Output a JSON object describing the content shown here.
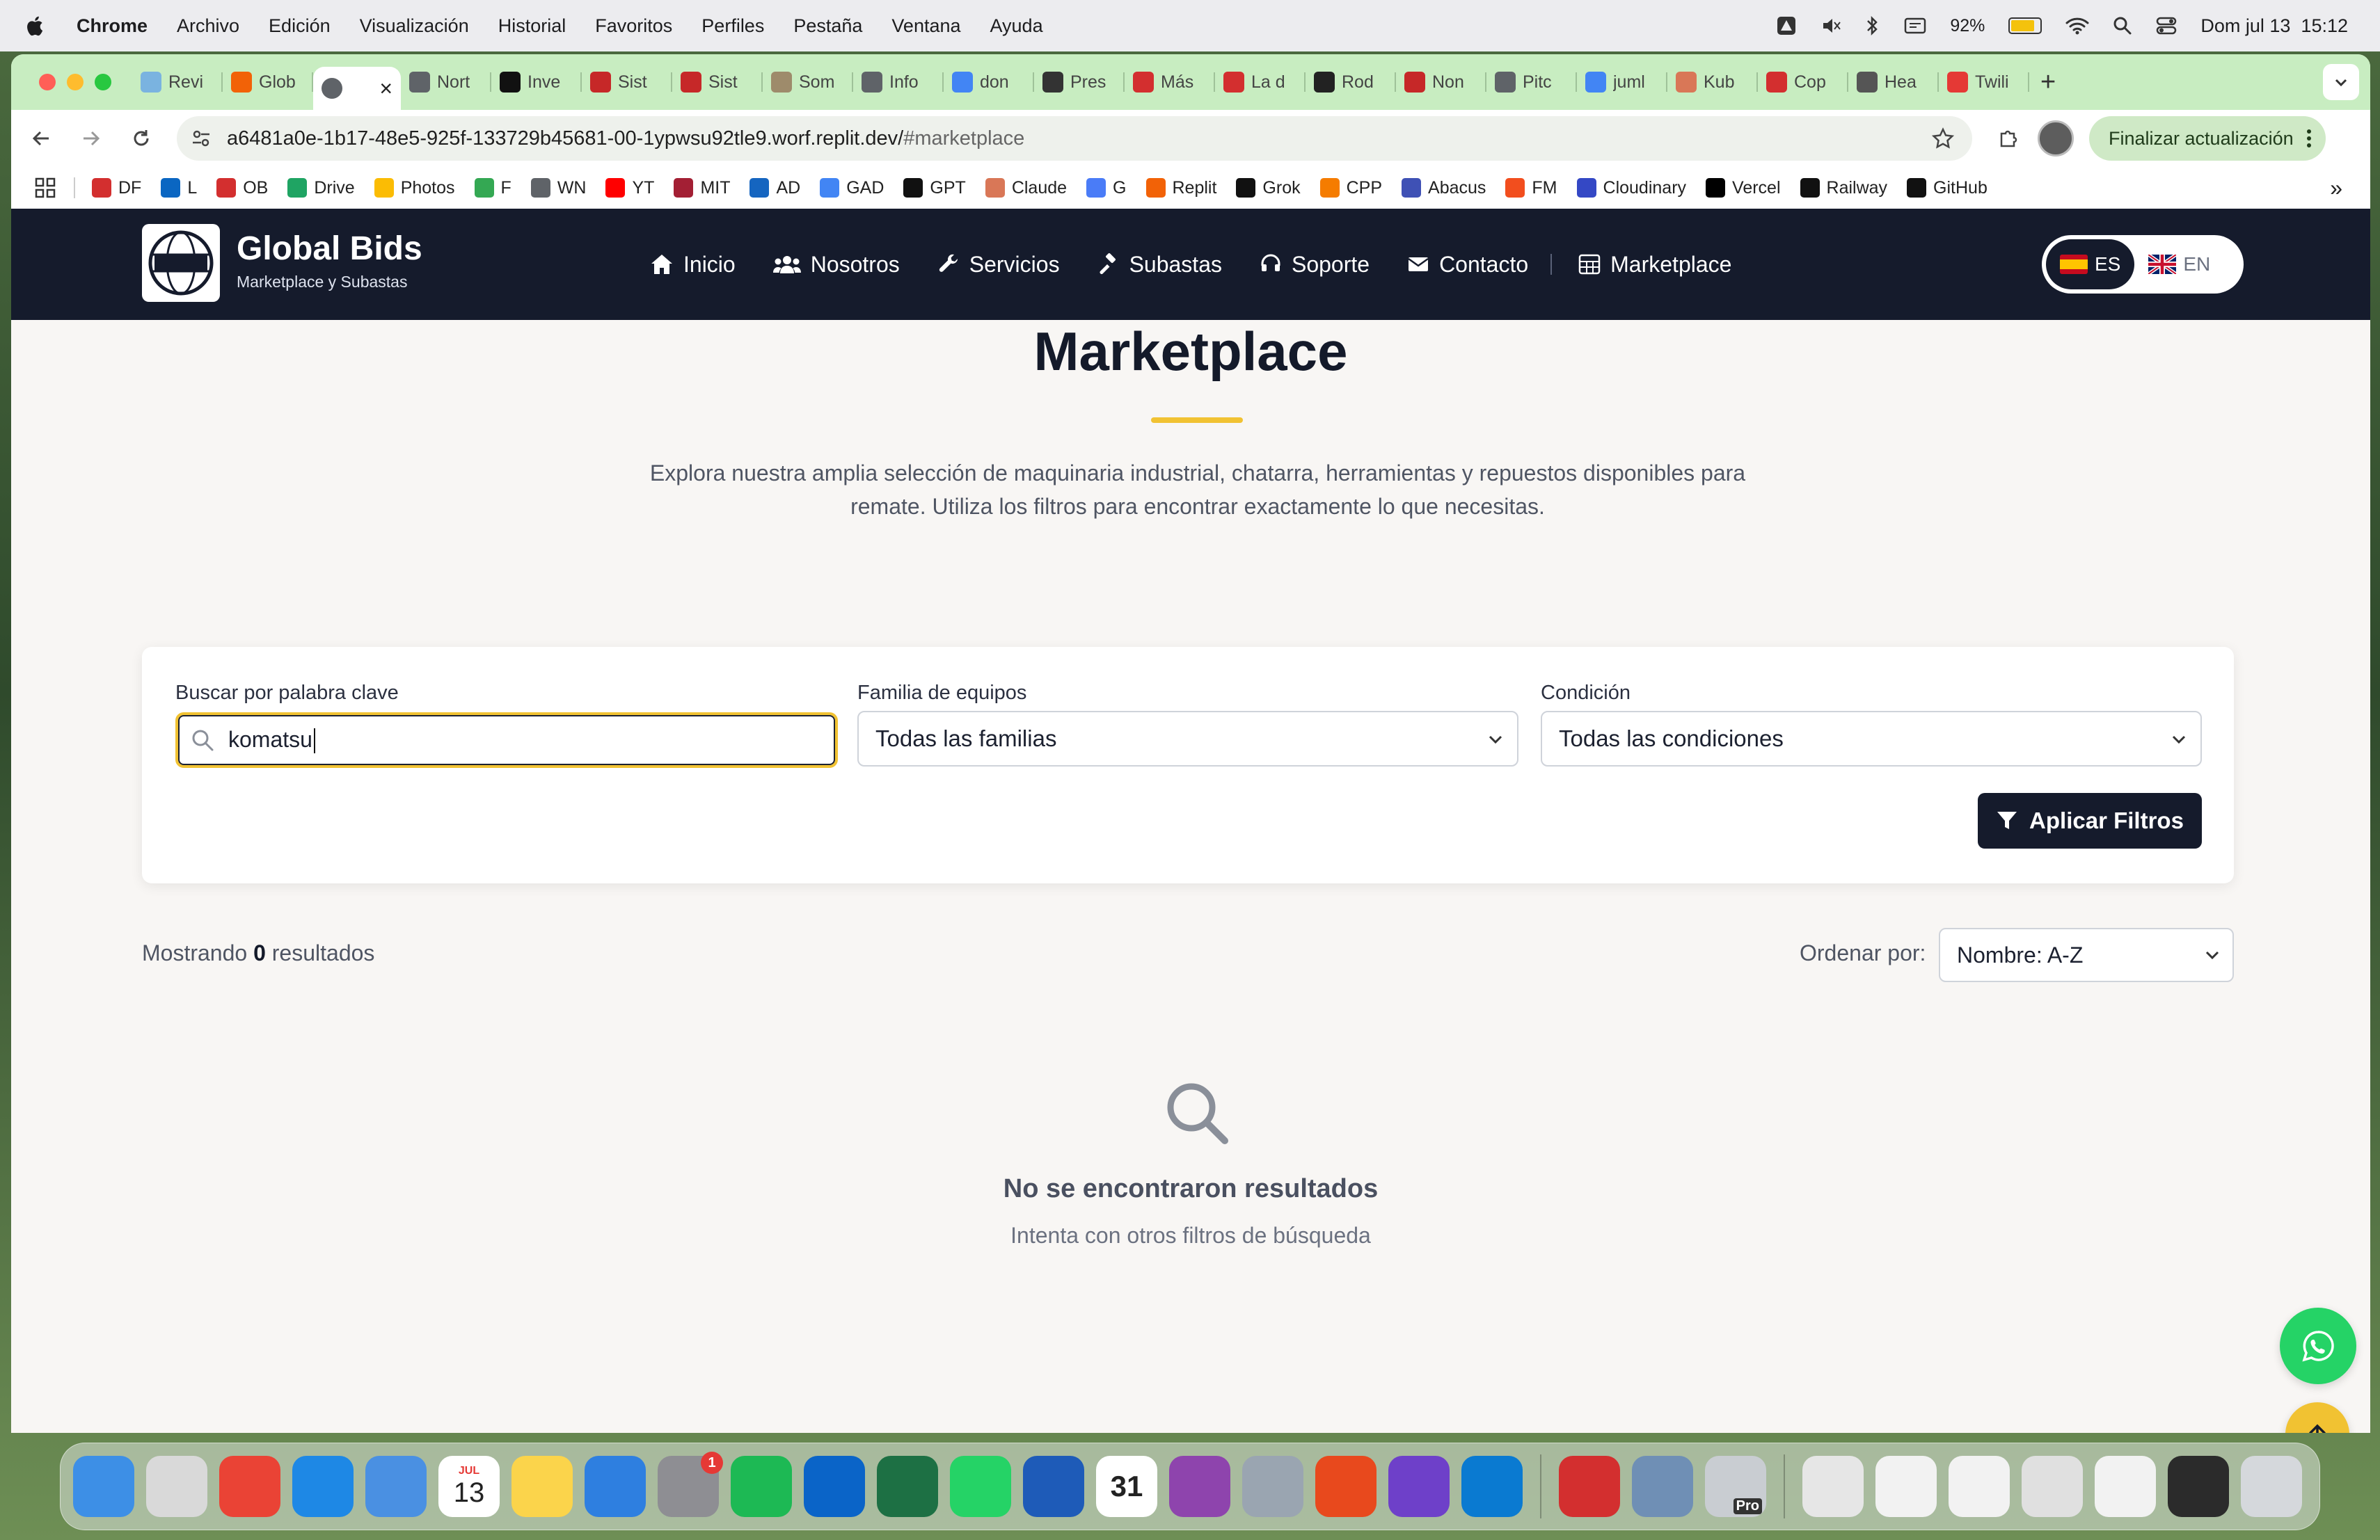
{
  "menubar": {
    "app": "Chrome",
    "items": [
      "Archivo",
      "Edición",
      "Visualización",
      "Historial",
      "Favoritos",
      "Perfiles",
      "Pestaña",
      "Ventana",
      "Ayuda"
    ],
    "battery": "92%",
    "battery_level": 0.92,
    "clock": "Dom jul 13  15:12"
  },
  "tabs": [
    {
      "title": "Revi",
      "color": "#7ab3e0"
    },
    {
      "title": "Glob",
      "color": "#f26207"
    },
    {
      "title": "",
      "color": "#5f6368",
      "active": true
    },
    {
      "title": "Nort",
      "color": "#5f6368"
    },
    {
      "title": "Inve",
      "color": "#111111"
    },
    {
      "title": "Sist",
      "color": "#c62828"
    },
    {
      "title": "Sist",
      "color": "#c62828"
    },
    {
      "title": "Som",
      "color": "#9e8b6b"
    },
    {
      "title": "Info",
      "color": "#5f6368"
    },
    {
      "title": "don",
      "color": "#4285f4"
    },
    {
      "title": "Pres",
      "color": "#333333"
    },
    {
      "title": "Más",
      "color": "#d32f2f"
    },
    {
      "title": "La d",
      "color": "#d32f2f"
    },
    {
      "title": "Rod",
      "color": "#222222"
    },
    {
      "title": "Non",
      "color": "#c62828"
    },
    {
      "title": "Pitc",
      "color": "#5f6368"
    },
    {
      "title": "juml",
      "color": "#4285f4"
    },
    {
      "title": "Kub",
      "color": "#d97757"
    },
    {
      "title": "Cop",
      "color": "#d32f2f"
    },
    {
      "title": "Hea",
      "color": "#555555"
    },
    {
      "title": "Twili",
      "color": "#e53935"
    }
  ],
  "address": {
    "url": "a6481a0e-1b17-48e5-925f-133729b45681-00-1ypwsu92tle9.worf.replit.dev/",
    "hash": "#marketplace"
  },
  "update_button": "Finalizar actualización",
  "bookmarks": [
    {
      "label": "DF",
      "color": "#d32f2f"
    },
    {
      "label": "L",
      "color": "#0a66c2"
    },
    {
      "label": "OB",
      "color": "#d32f2f"
    },
    {
      "label": "Drive",
      "color": "#1fa463"
    },
    {
      "label": "Photos",
      "color": "#fbbc04"
    },
    {
      "label": "F",
      "color": "#34a853"
    },
    {
      "label": "WN",
      "color": "#5f6368"
    },
    {
      "label": "YT",
      "color": "#ff0000"
    },
    {
      "label": "MIT",
      "color": "#a31f34"
    },
    {
      "label": "AD",
      "color": "#1565c0"
    },
    {
      "label": "GAD",
      "color": "#4285f4"
    },
    {
      "label": "GPT",
      "color": "#111111"
    },
    {
      "label": "Claude",
      "color": "#d97757"
    },
    {
      "label": "G",
      "color": "#4a7cf7"
    },
    {
      "label": "Replit",
      "color": "#f26207"
    },
    {
      "label": "Grok",
      "color": "#111111"
    },
    {
      "label": "CPP",
      "color": "#f57c00"
    },
    {
      "label": "Abacus",
      "color": "#3f51b5"
    },
    {
      "label": "FM",
      "color": "#f24e1e"
    },
    {
      "label": "Cloudinary",
      "color": "#3448c5"
    },
    {
      "label": "Vercel",
      "color": "#000000"
    },
    {
      "label": "Railway",
      "color": "#111111"
    },
    {
      "label": "GitHub",
      "color": "#111111"
    }
  ],
  "site": {
    "brand": "Global Bids",
    "tagline": "Marketplace y Subastas",
    "logo_text": "GLOBAL BIDS",
    "nav": [
      {
        "label": "Inicio",
        "icon": "home-icon"
      },
      {
        "label": "Nosotros",
        "icon": "users-icon"
      },
      {
        "label": "Servicios",
        "icon": "wrench-icon"
      },
      {
        "label": "Subastas",
        "icon": "gavel-icon"
      },
      {
        "label": "Soporte",
        "icon": "headset-icon"
      },
      {
        "label": "Contacto",
        "icon": "envelope-icon"
      },
      {
        "label": "Marketplace",
        "icon": "grid-icon"
      }
    ],
    "lang": {
      "es": "ES",
      "en": "EN"
    }
  },
  "marketplace": {
    "title": "Marketplace",
    "intro": "Explora nuestra amplia selección de maquinaria industrial, chatarra, herramientas y repuestos disponibles para remate. Utiliza los filtros para encontrar exactamente lo que necesitas.",
    "filters": {
      "search_label": "Buscar por palabra clave",
      "search_value": "komatsu",
      "family_label": "Familia de equipos",
      "family_value": "Todas las familias",
      "condition_label": "Condición",
      "condition_value": "Todas las condiciones",
      "apply": "Aplicar Filtros"
    },
    "results_prefix": "Mostrando",
    "results_count": "0",
    "results_suffix": "resultados",
    "sort_label": "Ordenar por:",
    "sort_value": "Nombre: A-Z",
    "empty_title": "No se encontraron resultados",
    "empty_subtitle": "Intenta con otros filtros de búsqueda"
  },
  "dock": {
    "calendar_month": "JUL",
    "calendar_day": "13",
    "settings_badge": "1",
    "calendar2_day": "31",
    "pro_label": "Pro",
    "apps": [
      {
        "name": "finder",
        "color": "#3d8fe6"
      },
      {
        "name": "launchpad",
        "color": "#d9d9d9"
      },
      {
        "name": "chrome",
        "color": "#ea4335"
      },
      {
        "name": "safari",
        "color": "#1e88e5"
      },
      {
        "name": "mail",
        "color": "#4a90e2"
      },
      {
        "name": "calendar",
        "color": "#ffffff"
      },
      {
        "name": "notes",
        "color": "#fbd44b"
      },
      {
        "name": "keynote",
        "color": "#2e7fe0"
      },
      {
        "name": "system-settings",
        "color": "#8e8e93"
      },
      {
        "name": "spotify",
        "color": "#1db954"
      },
      {
        "name": "outlook",
        "color": "#0a64c8"
      },
      {
        "name": "excel",
        "color": "#1d7044"
      },
      {
        "name": "whatsapp",
        "color": "#25d366"
      },
      {
        "name": "word",
        "color": "#1e5bb8"
      },
      {
        "name": "fantastical",
        "color": "#ffffff"
      },
      {
        "name": "podcasts",
        "color": "#8e44ad"
      },
      {
        "name": "ios-app-installer",
        "color": "#9aa5b1"
      },
      {
        "name": "zed",
        "color": "#e8491d"
      },
      {
        "name": "github-desktop",
        "color": "#6e40c9"
      },
      {
        "name": "vscode",
        "color": "#0a7ad1"
      },
      {
        "name": "acrobat",
        "color": "#d32f2f"
      },
      {
        "name": "preview",
        "color": "#6f8fb5"
      },
      {
        "name": "earth-pro",
        "color": "#c9cdd2"
      },
      {
        "name": "finder-stack",
        "color": "#e6e6e6"
      },
      {
        "name": "doc-stack-1",
        "color": "#f2f2f2"
      },
      {
        "name": "doc-stack-2",
        "color": "#f2f2f2"
      },
      {
        "name": "doc-stack-3",
        "color": "#e0e0e0"
      },
      {
        "name": "doc-stack-4",
        "color": "#f2f2f2"
      },
      {
        "name": "terminal-stack",
        "color": "#2b2b2b"
      },
      {
        "name": "trash",
        "color": "#d5d8dc"
      }
    ]
  }
}
